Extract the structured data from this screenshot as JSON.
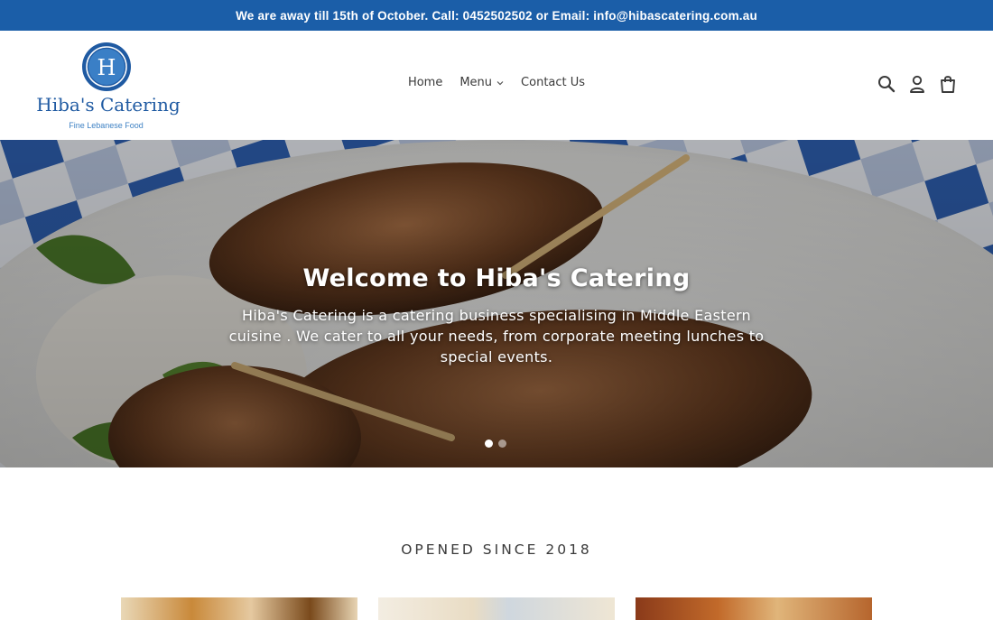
{
  "announcement": {
    "text": "We are away till 15th of October. Call: 0452502502 or Email: info@hibascatering.com.au"
  },
  "brand": {
    "logo_letter": "H",
    "name": "Hiba's Catering",
    "tagline": "Fine Lebanese Food",
    "color": "#1f5aa2"
  },
  "nav": {
    "items": [
      {
        "label": "Home"
      },
      {
        "label": "Menu",
        "has_dropdown": true
      },
      {
        "label": "Contact Us"
      }
    ]
  },
  "header_icons": [
    "search-icon",
    "account-icon",
    "cart-icon"
  ],
  "hero": {
    "title": "Welcome to Hiba's Catering",
    "subtitle": "Hiba's Catering is a catering business specialising in Middle Eastern cuisine . We cater to all your needs, from corporate meeting lunches to special events.",
    "slides": 2,
    "active_slide": 1
  },
  "section": {
    "heading": "OPENED SINCE 2018"
  },
  "colors": {
    "announcement_bg": "#1b5ea8",
    "text": "#3a3a3a",
    "white": "#ffffff"
  }
}
